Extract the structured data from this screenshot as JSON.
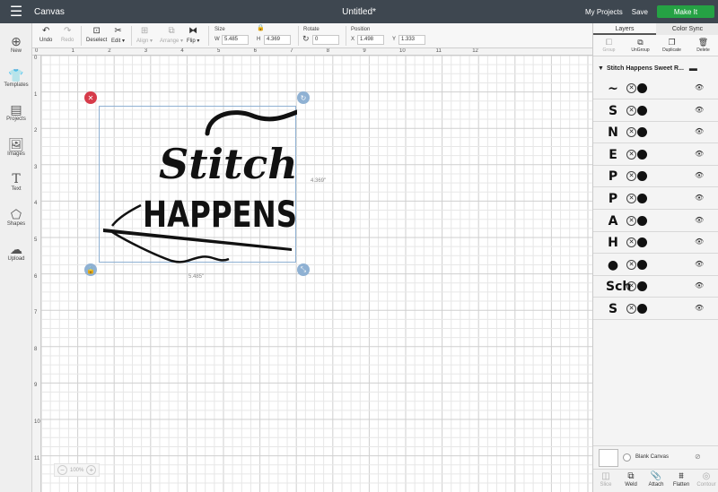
{
  "topbar": {
    "app_title": "Canvas",
    "doc_title": "Untitled*",
    "my_projects": "My Projects",
    "save": "Save",
    "make_it": "Make It"
  },
  "toolbar": {
    "undo": "Undo",
    "redo": "Redo",
    "deselect": "Deselect",
    "edit": "Edit",
    "align": "Align",
    "arrange": "Arrange",
    "flip": "Flip",
    "size_label": "Size",
    "w_label": "W",
    "w_value": "5.485",
    "h_label": "H",
    "h_value": "4.369",
    "rotate_label": "Rotate",
    "rotate_value": "0",
    "position_label": "Position",
    "x_label": "X",
    "x_value": "1.498",
    "y_label": "Y",
    "y_value": "1.333"
  },
  "leftbar": {
    "items": [
      "New",
      "Templates",
      "Projects",
      "Images",
      "Text",
      "Shapes",
      "Upload"
    ]
  },
  "canvas": {
    "ruler_h": [
      "0",
      "1",
      "2",
      "3",
      "4",
      "5",
      "6",
      "7",
      "8",
      "9",
      "10",
      "11",
      "12"
    ],
    "ruler_v": [
      "0",
      "1",
      "2",
      "3",
      "4",
      "5",
      "6",
      "7",
      "8",
      "9",
      "10",
      "11"
    ],
    "design_line1": "Stitch",
    "design_line2": "HAPPENS",
    "dim_width": "5.485\"",
    "dim_height": "4.369\"",
    "zoom": "100%"
  },
  "panel": {
    "tabs": [
      "Layers",
      "Color Sync"
    ],
    "tools": [
      "Group",
      "UnGroup",
      "Duplicate",
      "Delete"
    ],
    "group_name": "Stitch Happens Sweet R...",
    "layers": [
      {
        "thumb": "~"
      },
      {
        "thumb": "S"
      },
      {
        "thumb": "N"
      },
      {
        "thumb": "E"
      },
      {
        "thumb": "P"
      },
      {
        "thumb": "P"
      },
      {
        "thumb": "A"
      },
      {
        "thumb": "H"
      },
      {
        "thumb": "●"
      },
      {
        "thumb": "Sch"
      },
      {
        "thumb": "S"
      }
    ],
    "blank_canvas": "Blank Canvas",
    "bottom": [
      "Slice",
      "Weld",
      "Attach",
      "Flatten",
      "Contour"
    ]
  }
}
